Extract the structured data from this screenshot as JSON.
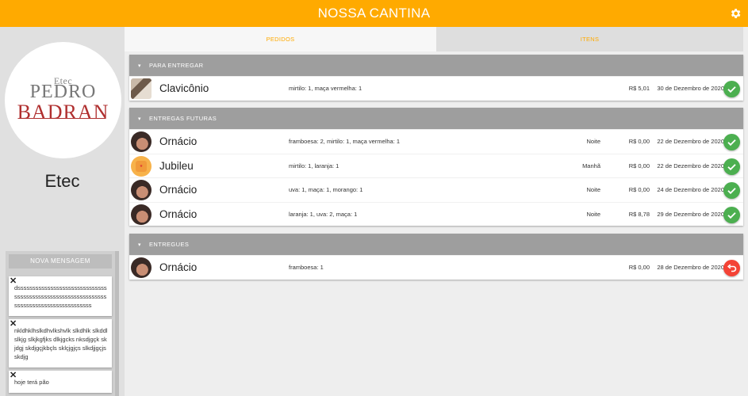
{
  "app": {
    "title": "NOSSA CANTINA",
    "settings_icon": "gear-icon"
  },
  "sidebar": {
    "logo": {
      "line1": "Etec",
      "line2": "PEDRO",
      "line3": "BADRAN"
    },
    "school_name": "Etec",
    "new_message_label": "NOVA MENSAGEM",
    "messages": [
      {
        "text": "dsssssssssssssssssssssssssssssssssssssssssssssssssssssssssssssssssssssssssssssssssssssss"
      },
      {
        "text": "nkldhklhslkdhvlkshvlk slkdhlk slkddl slkjg slkjkgfjks dlkjgcks nksdjgçk skjdgj skdjgçjkbçls sklçjgjçs slkdjjgçjs skdjg"
      },
      {
        "text": "hoje terá pão"
      }
    ]
  },
  "tabs": [
    {
      "label": "PEDIDOS",
      "active": true
    },
    {
      "label": "ITENS",
      "active": false
    }
  ],
  "sections": [
    {
      "title": "PARA ENTREGAR",
      "orders": [
        {
          "name": "Clavicônio",
          "items": "mirtilo: 1, maça vermelha: 1",
          "period": "",
          "price": "R$ 5,01",
          "date": "30 de Dezembro de 2020",
          "action": "check-icon"
        }
      ]
    },
    {
      "title": "ENTREGAS FUTURAS",
      "orders": [
        {
          "name": "Ornácio",
          "items": "framboesa: 2, mirtilo: 1, maça vermelha: 1",
          "period": "Noite",
          "price": "R$ 0,00",
          "date": "22 de Dezembro de 2020",
          "action": "check-icon"
        },
        {
          "name": "Jubileu",
          "items": "mirtilo: 1, laranja: 1",
          "period": "Manhã",
          "price": "R$ 0,00",
          "date": "22 de Dezembro de 2020",
          "action": "check-icon"
        },
        {
          "name": "Ornácio",
          "items": "uva: 1, maça: 1, morango: 1",
          "period": "Noite",
          "price": "R$ 0,00",
          "date": "24 de Dezembro de 2020",
          "action": "check-icon"
        },
        {
          "name": "Ornácio",
          "items": "laranja: 1, uva: 2, maça: 1",
          "period": "Noite",
          "price": "R$ 8,78",
          "date": "29 de Dezembro de 2020",
          "action": "check-icon"
        }
      ]
    },
    {
      "title": "ENTREGUES",
      "orders": [
        {
          "name": "Ornácio",
          "items": "framboesa: 1",
          "period": "",
          "price": "R$ 0,00",
          "date": "28 de Dezembro de 2020",
          "action": "undo-icon"
        }
      ]
    }
  ],
  "colors": {
    "primary": "#ffaa00",
    "success": "#4caf50",
    "danger": "#f44336",
    "section_header": "#9e9e9e"
  }
}
